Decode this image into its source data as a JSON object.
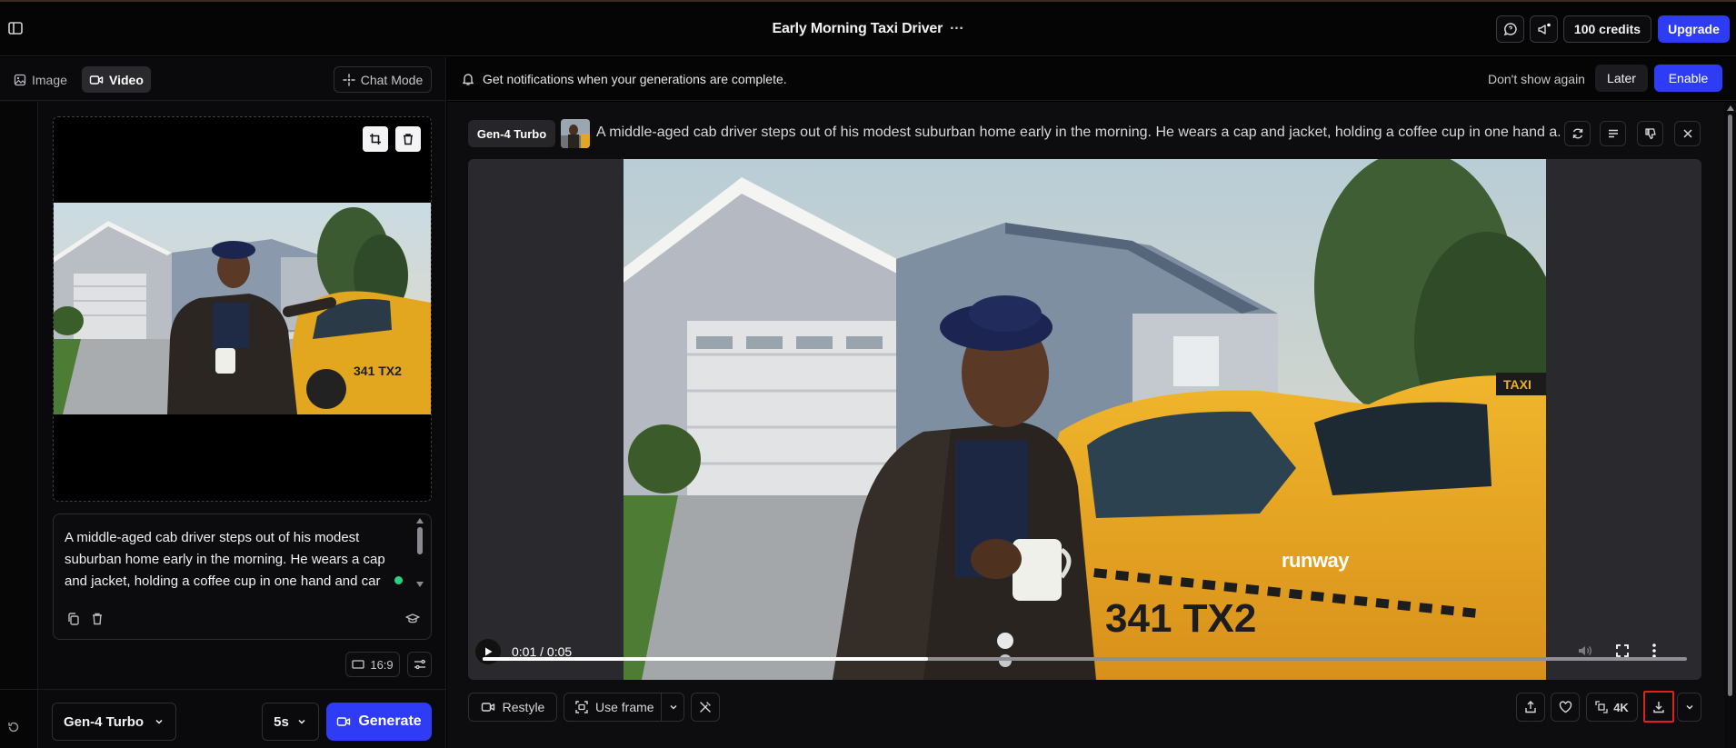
{
  "header": {
    "title": "Early Morning Taxi Driver",
    "more": "···",
    "credits_label": "100 credits",
    "upgrade_label": "Upgrade"
  },
  "modes": {
    "image_label": "Image",
    "video_label": "Video",
    "chat_mode_label": "Chat Mode"
  },
  "notification": {
    "message": "Get notifications when your generations are complete.",
    "dismiss_label": "Don't show again",
    "later_label": "Later",
    "enable_label": "Enable"
  },
  "prompt": {
    "text": "A middle-aged cab driver steps out of his modest suburban home early in the morning. He wears a cap and jacket, holding a coffee cup in one hand and car keys in the other. The sun is rising softly in the"
  },
  "settings": {
    "aspect_ratio": "16:9",
    "model": "Gen-4 Turbo",
    "duration": "5s",
    "generate_label": "Generate"
  },
  "generation": {
    "model_badge": "Gen-4 Turbo",
    "prompt_preview": "A middle-aged cab driver steps out of his modest suburban home early in the morning. He wears a cap and jacket, holding a coffee cup in one hand a..."
  },
  "player": {
    "time": "0:01 / 0:05",
    "watermark": "runway",
    "progress": 0.37
  },
  "actions": {
    "restyle_label": "Restyle",
    "use_frame_label": "Use frame",
    "upscale_label": "4K"
  },
  "scene_text": {
    "taxi_sign": "TAXI",
    "taxi_number": "341 TX2",
    "thumb_taxi_number": "341 TX2"
  },
  "colors": {
    "accent": "#2f3cf5",
    "background": "#000000",
    "panel": "#0d0d10",
    "taxi": "#e8a51c",
    "highlight": "#e02020"
  }
}
